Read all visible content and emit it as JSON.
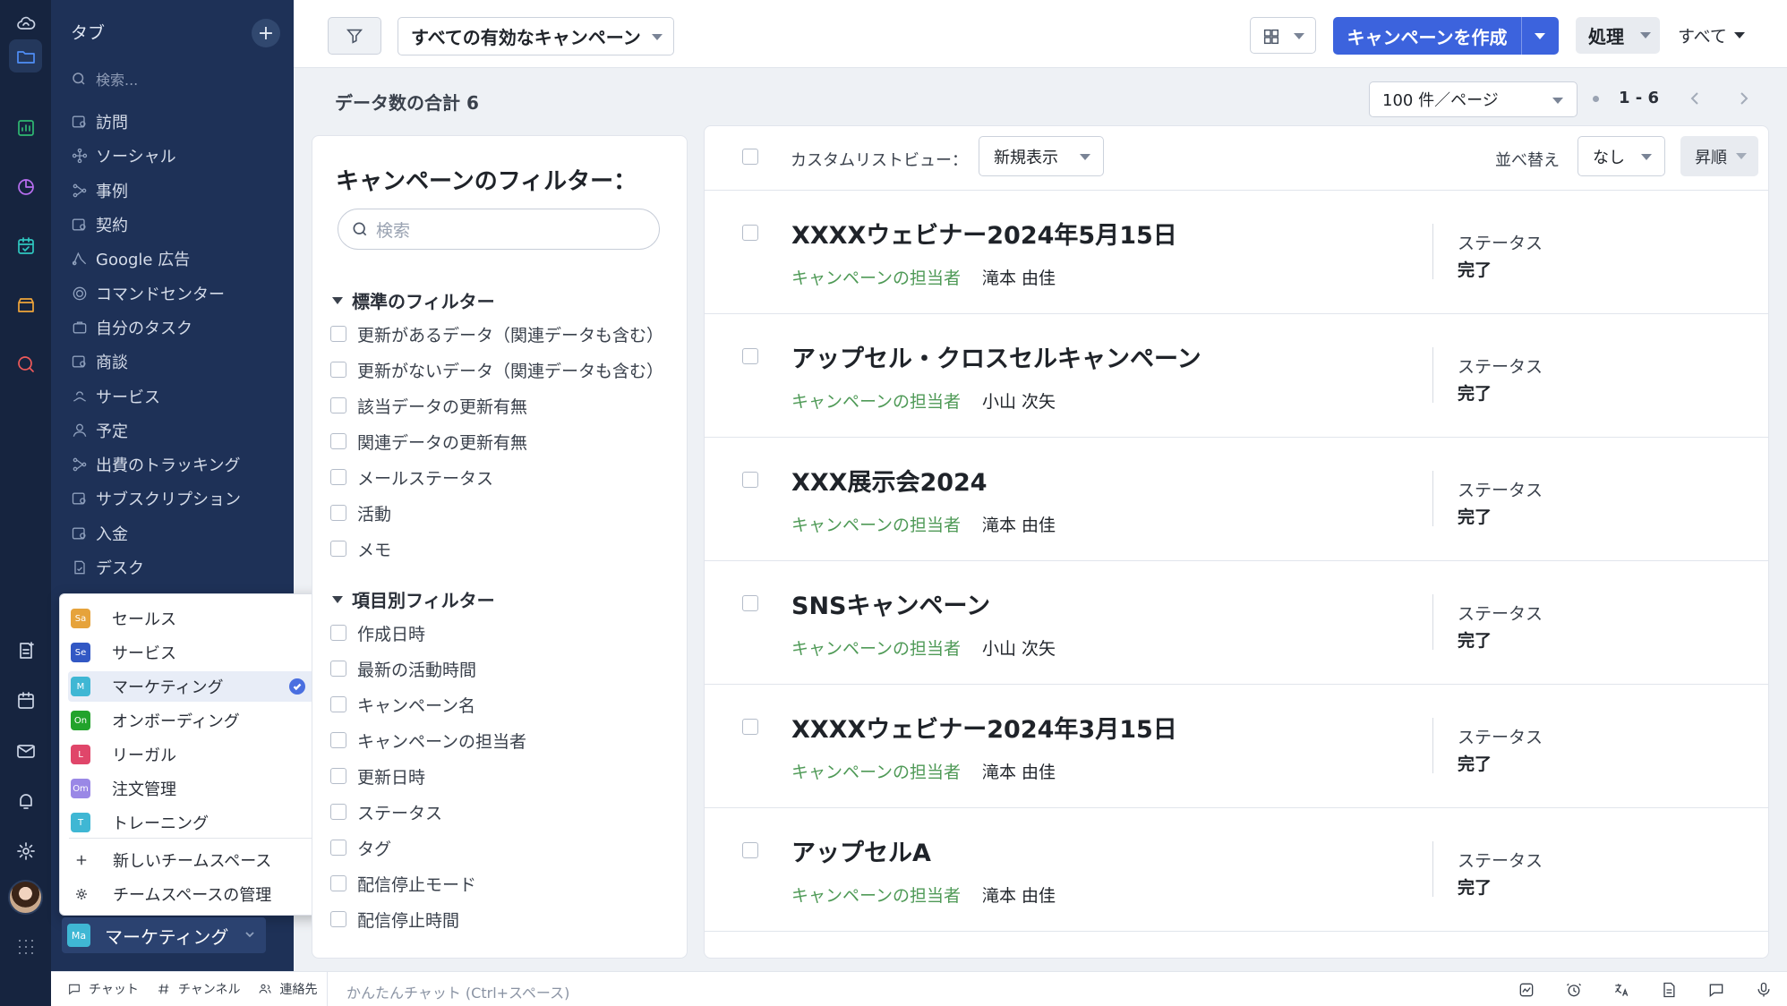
{
  "sidebar": {
    "header": "タブ",
    "add_label": "+",
    "search_placeholder": "検索...",
    "items": [
      {
        "label": "訪問",
        "icon": "visit-icon"
      },
      {
        "label": "ソーシャル",
        "icon": "social-icon"
      },
      {
        "label": "事例",
        "icon": "case-icon"
      },
      {
        "label": "契約",
        "icon": "contract-icon"
      },
      {
        "label": "Google 広告",
        "icon": "google-ads-icon"
      },
      {
        "label": "コマンドセンター",
        "icon": "command-center-icon"
      },
      {
        "label": "自分のタスク",
        "icon": "task-icon"
      },
      {
        "label": "商談",
        "icon": "deal-icon"
      },
      {
        "label": "サービス",
        "icon": "service-icon"
      },
      {
        "label": "予定",
        "icon": "schedule-icon"
      },
      {
        "label": "出費のトラッキング",
        "icon": "expense-icon"
      },
      {
        "label": "サブスクリプション",
        "icon": "subscription-icon"
      },
      {
        "label": "入金",
        "icon": "payment-icon"
      },
      {
        "label": "デスク",
        "icon": "desk-icon"
      }
    ]
  },
  "team_menu": {
    "teams": [
      {
        "badge": "Sa",
        "label": "セールス",
        "color": "#e6a33b"
      },
      {
        "badge": "Se",
        "label": "サービス",
        "color": "#3258c4"
      },
      {
        "badge": "M",
        "label": "マーケティング",
        "color": "#3fb7d4",
        "selected": true
      },
      {
        "badge": "On",
        "label": "オンボーディング",
        "color": "#22a32c"
      },
      {
        "badge": "L",
        "label": "リーガル",
        "color": "#e0466a"
      },
      {
        "badge": "Om",
        "label": "注文管理",
        "color": "#9a88e6"
      },
      {
        "badge": "T",
        "label": "トレーニング",
        "color": "#3fb7d4"
      }
    ],
    "new_space": "新しいチームスペース",
    "manage_space": "チームスペースの管理",
    "current": {
      "badge": "Ma",
      "label": "マーケティング",
      "color": "#3fb7d4"
    }
  },
  "toolbar": {
    "view_label": "すべての有効なキャンペーン",
    "create_label": "キャンペーンを作成",
    "action_label": "処理",
    "all_label": "すべて"
  },
  "summary": {
    "total_label": "データ数の合計 6",
    "per_page": "100 件／ページ",
    "range": "1 - 6"
  },
  "filter_panel": {
    "title": "キャンペーンのフィルター：",
    "search_placeholder": "検索",
    "standard_title": "標準のフィルター",
    "standard": [
      "更新があるデータ（関連データも含む）",
      "更新がないデータ（関連データも含む）",
      "該当データの更新有無",
      "関連データの更新有無",
      "メールステータス",
      "活動",
      "メモ"
    ],
    "field_title": "項目別フィルター",
    "fields": [
      "作成日時",
      "最新の活動時間",
      "キャンペーン名",
      "キャンペーンの担当者",
      "更新日時",
      "ステータス",
      "タグ",
      "配信停止モード",
      "配信停止時間"
    ]
  },
  "list": {
    "custom_view_label": "カスタムリストビュー：",
    "custom_view_value": "新規表示",
    "sort_label": "並べ替え",
    "sort_value": "なし",
    "order_value": "昇順",
    "owner_label": "キャンペーンの担当者",
    "status_label": "ステータス",
    "rows": [
      {
        "title": "XXXXウェビナー2024年5月15日",
        "owner": "滝本 由佳",
        "status": "完了"
      },
      {
        "title": "アップセル・クロスセルキャンペーン",
        "owner": "小山 次矢",
        "status": "完了"
      },
      {
        "title": "XXX展示会2024",
        "owner": "滝本 由佳",
        "status": "完了"
      },
      {
        "title": "SNSキャンペーン",
        "owner": "小山 次矢",
        "status": "完了"
      },
      {
        "title": "XXXXウェビナー2024年3月15日",
        "owner": "滝本 由佳",
        "status": "完了"
      },
      {
        "title": "アップセルA",
        "owner": "滝本 由佳",
        "status": "完了"
      }
    ]
  },
  "bottombar": {
    "chat": "チャット",
    "channel": "チャンネル",
    "contacts": "連絡先",
    "chat_placeholder": "かんたんチャット (Ctrl+スペース)"
  }
}
